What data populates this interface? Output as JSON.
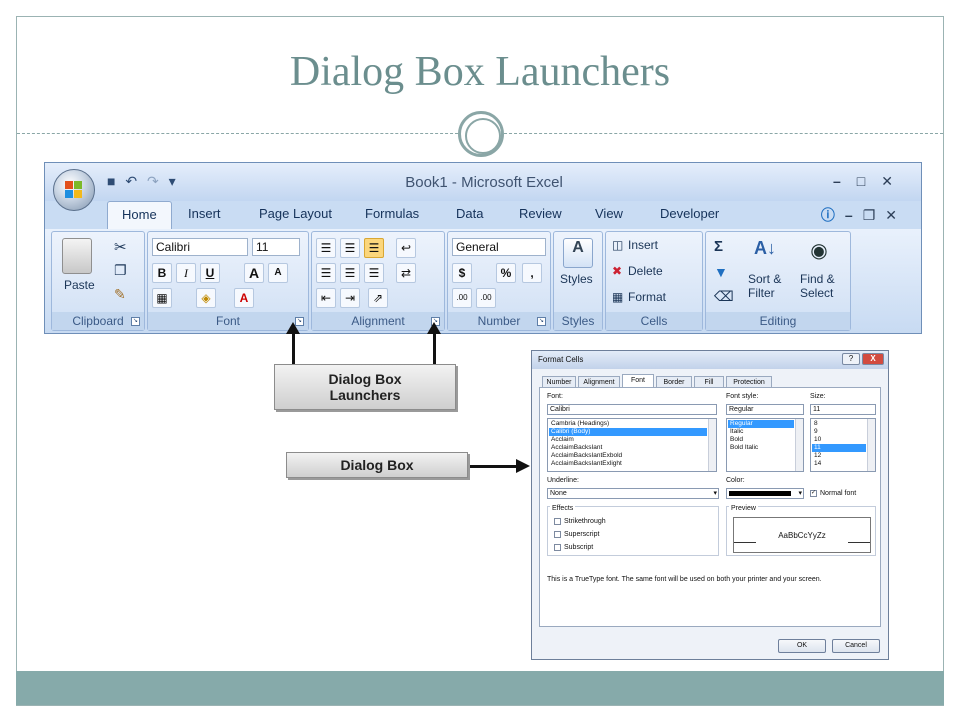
{
  "slide": {
    "title": "Dialog Box Launchers"
  },
  "excel": {
    "window_title": "Book1 - Microsoft Excel",
    "qat_icons": [
      "save-icon",
      "undo-icon",
      "redo-icon",
      "customize-icon"
    ],
    "tabs": [
      "Home",
      "Insert",
      "Page Layout",
      "Formulas",
      "Data",
      "Review",
      "View",
      "Developer"
    ],
    "groups": {
      "clipboard": {
        "label": "Clipboard",
        "paste": "Paste"
      },
      "font": {
        "label": "Font",
        "font_name": "Calibri",
        "font_size": "11",
        "bold": "B",
        "italic": "I",
        "underline": "U",
        "grow": "A",
        "shrink": "A"
      },
      "alignment": {
        "label": "Alignment"
      },
      "number": {
        "label": "Number",
        "format": "General",
        "currency": "$",
        "percent": "%",
        "comma": ",",
        "inc_dec": ".00",
        "dec_dec": ".00"
      },
      "styles": {
        "label": "Styles",
        "styles_btn": "Styles"
      },
      "cells": {
        "label": "Cells",
        "insert": "Insert",
        "delete": "Delete",
        "format": "Format"
      },
      "editing": {
        "label": "Editing",
        "sort": "Sort &",
        "sort2": "Filter",
        "find": "Find &",
        "find2": "Select",
        "sigma": "Σ"
      }
    }
  },
  "callouts": {
    "launchers_line1": "Dialog Box",
    "launchers_line2": "Launchers",
    "dialog": "Dialog Box"
  },
  "dialog": {
    "title": "Format Cells",
    "tabs": [
      "Number",
      "Alignment",
      "Font",
      "Border",
      "Fill",
      "Protection"
    ],
    "active_tab": "Font",
    "font_label": "Font:",
    "font_value": "Calibri",
    "font_list": [
      "Cambria (Headings)",
      "Calibri (Body)",
      "Acclaim",
      "AcclaimBacksIant",
      "AcclaimBacksIantExbold",
      "AcclaimBacksIantExlight"
    ],
    "font_style_label": "Font style:",
    "font_style_value": "Regular",
    "font_style_list": [
      "Regular",
      "Italic",
      "Bold",
      "Bold Italic"
    ],
    "size_label": "Size:",
    "size_value": "11",
    "size_list": [
      "8",
      "9",
      "10",
      "11",
      "12",
      "14"
    ],
    "underline_label": "Underline:",
    "underline_value": "None",
    "color_label": "Color:",
    "normal_font": "Normal font",
    "effects_label": "Effects",
    "effects": [
      "Strikethrough",
      "Superscript",
      "Subscript"
    ],
    "preview_label": "Preview",
    "preview_text": "AaBbCcYyZz",
    "info": "This is a TrueType font.  The same font will be used on both your printer and your screen.",
    "ok": "OK",
    "cancel": "Cancel",
    "help": "?",
    "close": "X"
  }
}
